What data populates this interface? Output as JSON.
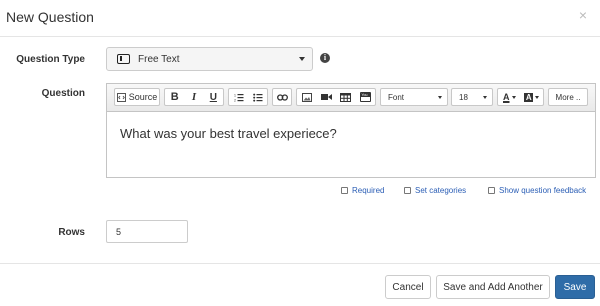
{
  "modal": {
    "title": "New Question",
    "close_label": "×"
  },
  "question_type": {
    "label": "Question Type",
    "selected": "Free Text",
    "info_label": "i"
  },
  "question": {
    "label": "Question",
    "content": "What was your best travel experiece?",
    "toolbar": {
      "source_label": "Source",
      "bold": "B",
      "italic": "I",
      "underline": "U",
      "font_label": "Font",
      "size_label": "18",
      "text_color_label": "A",
      "bg_color_label": "A",
      "more_label": "More .."
    }
  },
  "options": {
    "required": "Required",
    "set_categories": "Set categories",
    "show_feedback": "Show question feedback"
  },
  "rows": {
    "label": "Rows",
    "value": "5"
  },
  "footer": {
    "cancel": "Cancel",
    "save_add_another": "Save and Add Another",
    "save": "Save"
  },
  "colors": {
    "primary": "#2f6ca8",
    "link": "#2b5eb5"
  }
}
